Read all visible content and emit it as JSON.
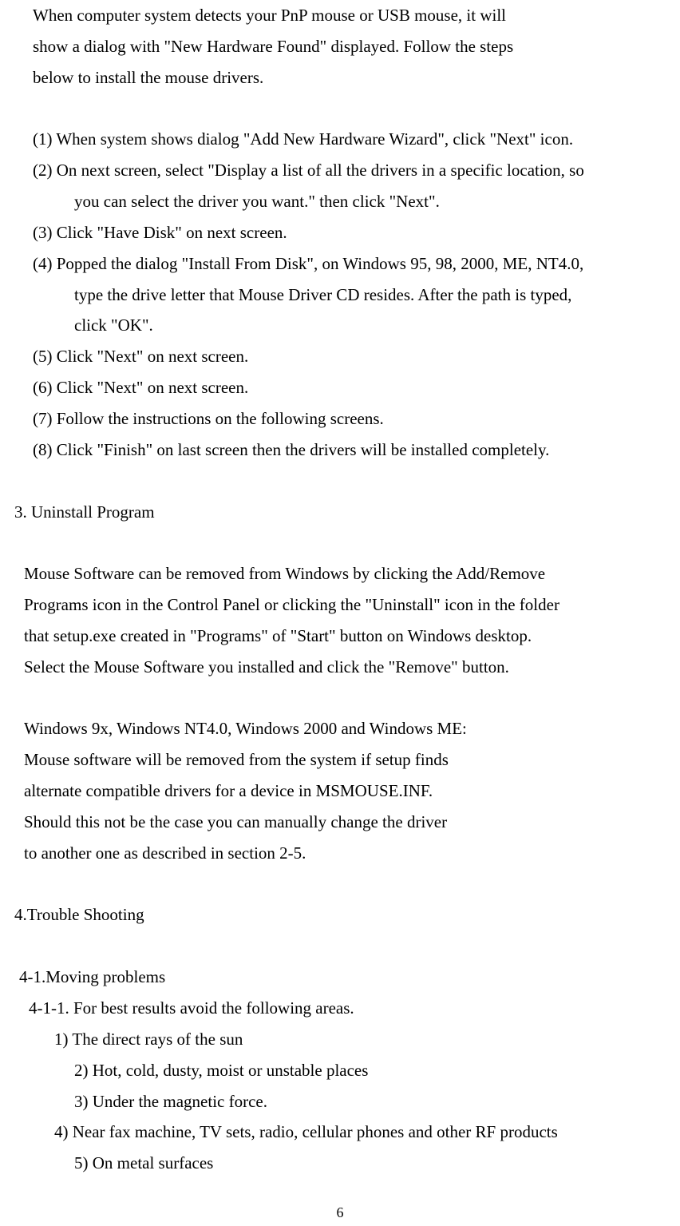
{
  "intro": {
    "l1": "When computer system detects your PnP mouse or USB mouse, it will",
    "l2": "show a dialog with \"New Hardware Found\" displayed. Follow the steps",
    "l3": "below to install the mouse drivers."
  },
  "steps": {
    "s1": "(1) When system shows dialog \"Add New Hardware Wizard\", click \"Next\" icon.",
    "s2": "(2) On next screen, select \"Display a list of all the drivers in a specific location, so",
    "s2c": "you can select the driver you want.\" then click \"Next\".",
    "s3": "(3) Click \"Have Disk\" on next screen.",
    "s4": "(4) Popped the dialog \"Install From Disk\", on Windows 95, 98, 2000, ME, NT4.0,",
    "s4c1": "type the drive letter that Mouse Driver CD resides. After the path is typed,",
    "s4c2": "click \"OK\".",
    "s5": "(5) Click \"Next\" on next screen.",
    "s6": "(6) Click \"Next\" on next screen.",
    "s7": "(7) Follow the instructions on the following screens.",
    "s8": "(8) Click \"Finish\" on last screen then the drivers will be installed completely."
  },
  "sec3": {
    "head": "3. Uninstall Program",
    "p1l1": "Mouse Software can be removed from Windows by clicking the Add/Remove",
    "p1l2": "Programs icon in the Control Panel or clicking the \"Uninstall\" icon in the folder",
    "p1l3": "that setup.exe created in \"Programs\" of \"Start\" button on Windows desktop.",
    "p1l4": "Select the Mouse Software you installed and click the \"Remove\" button.",
    "p2l1": "Windows 9x, Windows NT4.0, Windows 2000 and Windows ME:",
    "p2l2": "Mouse software will be removed from the system if setup finds",
    "p2l3": "alternate compatible drivers for a device in MSMOUSE.INF.",
    "p2l4": "Should this not be the case you can manually change the driver",
    "p2l5": "to another one as described in section 2-5."
  },
  "sec4": {
    "head": "4.Trouble Shooting",
    "sub": "4-1.Moving problems",
    "subsub": "4-1-1. For best results avoid the following areas.",
    "i1": "1) The direct rays of the sun",
    "i2": "2) Hot, cold, dusty, moist or unstable places",
    "i3": "3) Under the magnetic force.",
    "i4": "4) Near fax machine, TV sets, radio, cellular phones and other RF products",
    "i5": "5) On metal surfaces"
  },
  "pagenum": "6"
}
